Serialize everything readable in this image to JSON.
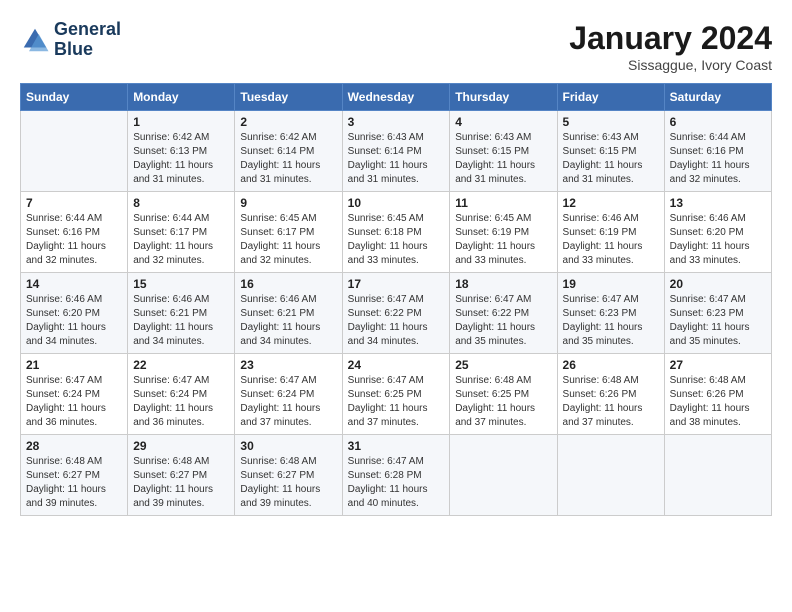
{
  "header": {
    "logo_line1": "General",
    "logo_line2": "Blue",
    "month_title": "January 2024",
    "location": "Sissaggue, Ivory Coast"
  },
  "weekdays": [
    "Sunday",
    "Monday",
    "Tuesday",
    "Wednesday",
    "Thursday",
    "Friday",
    "Saturday"
  ],
  "weeks": [
    [
      {
        "day": "",
        "sunrise": "",
        "sunset": "",
        "daylight": ""
      },
      {
        "day": "1",
        "sunrise": "Sunrise: 6:42 AM",
        "sunset": "Sunset: 6:13 PM",
        "daylight": "Daylight: 11 hours and 31 minutes."
      },
      {
        "day": "2",
        "sunrise": "Sunrise: 6:42 AM",
        "sunset": "Sunset: 6:14 PM",
        "daylight": "Daylight: 11 hours and 31 minutes."
      },
      {
        "day": "3",
        "sunrise": "Sunrise: 6:43 AM",
        "sunset": "Sunset: 6:14 PM",
        "daylight": "Daylight: 11 hours and 31 minutes."
      },
      {
        "day": "4",
        "sunrise": "Sunrise: 6:43 AM",
        "sunset": "Sunset: 6:15 PM",
        "daylight": "Daylight: 11 hours and 31 minutes."
      },
      {
        "day": "5",
        "sunrise": "Sunrise: 6:43 AM",
        "sunset": "Sunset: 6:15 PM",
        "daylight": "Daylight: 11 hours and 31 minutes."
      },
      {
        "day": "6",
        "sunrise": "Sunrise: 6:44 AM",
        "sunset": "Sunset: 6:16 PM",
        "daylight": "Daylight: 11 hours and 32 minutes."
      }
    ],
    [
      {
        "day": "7",
        "sunrise": "Sunrise: 6:44 AM",
        "sunset": "Sunset: 6:16 PM",
        "daylight": "Daylight: 11 hours and 32 minutes."
      },
      {
        "day": "8",
        "sunrise": "Sunrise: 6:44 AM",
        "sunset": "Sunset: 6:17 PM",
        "daylight": "Daylight: 11 hours and 32 minutes."
      },
      {
        "day": "9",
        "sunrise": "Sunrise: 6:45 AM",
        "sunset": "Sunset: 6:17 PM",
        "daylight": "Daylight: 11 hours and 32 minutes."
      },
      {
        "day": "10",
        "sunrise": "Sunrise: 6:45 AM",
        "sunset": "Sunset: 6:18 PM",
        "daylight": "Daylight: 11 hours and 33 minutes."
      },
      {
        "day": "11",
        "sunrise": "Sunrise: 6:45 AM",
        "sunset": "Sunset: 6:19 PM",
        "daylight": "Daylight: 11 hours and 33 minutes."
      },
      {
        "day": "12",
        "sunrise": "Sunrise: 6:46 AM",
        "sunset": "Sunset: 6:19 PM",
        "daylight": "Daylight: 11 hours and 33 minutes."
      },
      {
        "day": "13",
        "sunrise": "Sunrise: 6:46 AM",
        "sunset": "Sunset: 6:20 PM",
        "daylight": "Daylight: 11 hours and 33 minutes."
      }
    ],
    [
      {
        "day": "14",
        "sunrise": "Sunrise: 6:46 AM",
        "sunset": "Sunset: 6:20 PM",
        "daylight": "Daylight: 11 hours and 34 minutes."
      },
      {
        "day": "15",
        "sunrise": "Sunrise: 6:46 AM",
        "sunset": "Sunset: 6:21 PM",
        "daylight": "Daylight: 11 hours and 34 minutes."
      },
      {
        "day": "16",
        "sunrise": "Sunrise: 6:46 AM",
        "sunset": "Sunset: 6:21 PM",
        "daylight": "Daylight: 11 hours and 34 minutes."
      },
      {
        "day": "17",
        "sunrise": "Sunrise: 6:47 AM",
        "sunset": "Sunset: 6:22 PM",
        "daylight": "Daylight: 11 hours and 34 minutes."
      },
      {
        "day": "18",
        "sunrise": "Sunrise: 6:47 AM",
        "sunset": "Sunset: 6:22 PM",
        "daylight": "Daylight: 11 hours and 35 minutes."
      },
      {
        "day": "19",
        "sunrise": "Sunrise: 6:47 AM",
        "sunset": "Sunset: 6:23 PM",
        "daylight": "Daylight: 11 hours and 35 minutes."
      },
      {
        "day": "20",
        "sunrise": "Sunrise: 6:47 AM",
        "sunset": "Sunset: 6:23 PM",
        "daylight": "Daylight: 11 hours and 35 minutes."
      }
    ],
    [
      {
        "day": "21",
        "sunrise": "Sunrise: 6:47 AM",
        "sunset": "Sunset: 6:24 PM",
        "daylight": "Daylight: 11 hours and 36 minutes."
      },
      {
        "day": "22",
        "sunrise": "Sunrise: 6:47 AM",
        "sunset": "Sunset: 6:24 PM",
        "daylight": "Daylight: 11 hours and 36 minutes."
      },
      {
        "day": "23",
        "sunrise": "Sunrise: 6:47 AM",
        "sunset": "Sunset: 6:24 PM",
        "daylight": "Daylight: 11 hours and 37 minutes."
      },
      {
        "day": "24",
        "sunrise": "Sunrise: 6:47 AM",
        "sunset": "Sunset: 6:25 PM",
        "daylight": "Daylight: 11 hours and 37 minutes."
      },
      {
        "day": "25",
        "sunrise": "Sunrise: 6:48 AM",
        "sunset": "Sunset: 6:25 PM",
        "daylight": "Daylight: 11 hours and 37 minutes."
      },
      {
        "day": "26",
        "sunrise": "Sunrise: 6:48 AM",
        "sunset": "Sunset: 6:26 PM",
        "daylight": "Daylight: 11 hours and 37 minutes."
      },
      {
        "day": "27",
        "sunrise": "Sunrise: 6:48 AM",
        "sunset": "Sunset: 6:26 PM",
        "daylight": "Daylight: 11 hours and 38 minutes."
      }
    ],
    [
      {
        "day": "28",
        "sunrise": "Sunrise: 6:48 AM",
        "sunset": "Sunset: 6:27 PM",
        "daylight": "Daylight: 11 hours and 39 minutes."
      },
      {
        "day": "29",
        "sunrise": "Sunrise: 6:48 AM",
        "sunset": "Sunset: 6:27 PM",
        "daylight": "Daylight: 11 hours and 39 minutes."
      },
      {
        "day": "30",
        "sunrise": "Sunrise: 6:48 AM",
        "sunset": "Sunset: 6:27 PM",
        "daylight": "Daylight: 11 hours and 39 minutes."
      },
      {
        "day": "31",
        "sunrise": "Sunrise: 6:47 AM",
        "sunset": "Sunset: 6:28 PM",
        "daylight": "Daylight: 11 hours and 40 minutes."
      },
      {
        "day": "",
        "sunrise": "",
        "sunset": "",
        "daylight": ""
      },
      {
        "day": "",
        "sunrise": "",
        "sunset": "",
        "daylight": ""
      },
      {
        "day": "",
        "sunrise": "",
        "sunset": "",
        "daylight": ""
      }
    ]
  ]
}
